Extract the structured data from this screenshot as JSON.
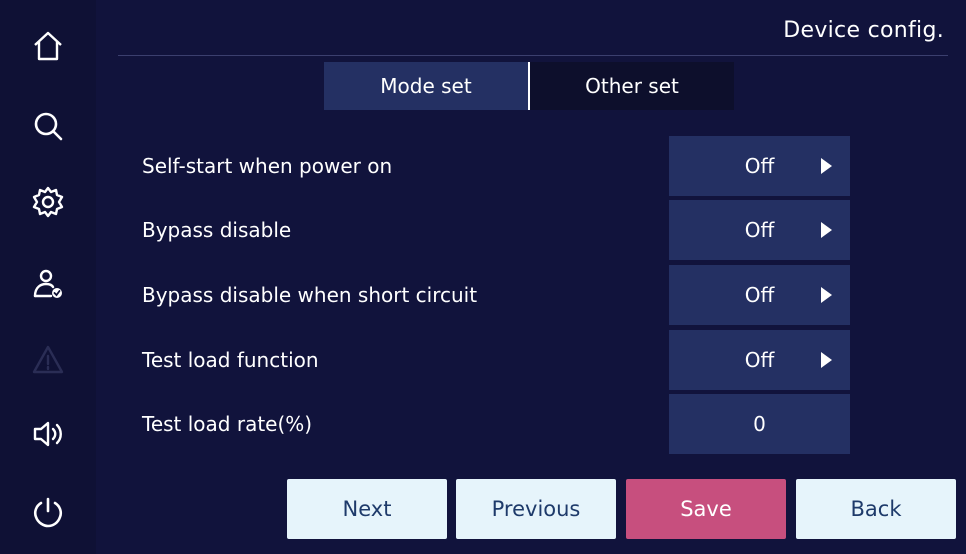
{
  "header": {
    "title": "Device config."
  },
  "tabs": [
    {
      "label": "Mode set",
      "active": true
    },
    {
      "label": "Other set",
      "active": false
    }
  ],
  "settings": [
    {
      "label": "Self-start when power on",
      "value": "Off",
      "has_arrow": true
    },
    {
      "label": "Bypass disable",
      "value": "Off",
      "has_arrow": true
    },
    {
      "label": "Bypass disable when short circuit",
      "value": "Off",
      "has_arrow": true
    },
    {
      "label": "Test load function",
      "value": "Off",
      "has_arrow": true
    },
    {
      "label": "Test load rate(%)",
      "value": "0",
      "has_arrow": false
    }
  ],
  "buttons": {
    "next": "Next",
    "previous": "Previous",
    "save": "Save",
    "back": "Back"
  },
  "sidebar": {
    "items": [
      {
        "icon": "home-icon"
      },
      {
        "icon": "search-icon"
      },
      {
        "icon": "gear-icon"
      },
      {
        "icon": "user-check-icon"
      },
      {
        "icon": "warning-icon",
        "disabled": true
      },
      {
        "icon": "speaker-icon"
      },
      {
        "icon": "power-icon"
      }
    ]
  },
  "colors": {
    "background": "#11133c",
    "panel": "#243063",
    "light_button": "#e6f4fb",
    "save_button": "#c74f7e"
  }
}
